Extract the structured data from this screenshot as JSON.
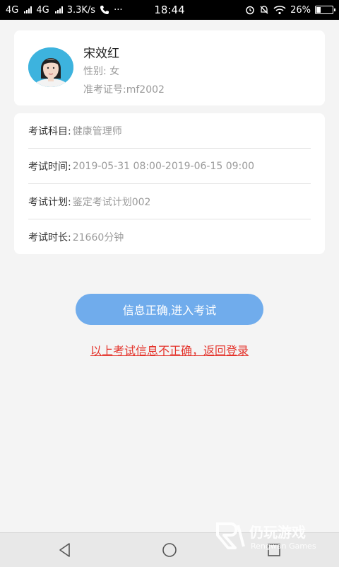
{
  "status_bar": {
    "network1": "4G",
    "network2": "4G",
    "speed": "3.3K/s",
    "more": "···",
    "time": "18:44",
    "battery": "26%",
    "battery_level": 0.26
  },
  "profile": {
    "name": "宋效红",
    "gender_label": "性别: ",
    "gender_value": "女",
    "examno_label": "准考证号:",
    "examno_value": "mf2002"
  },
  "exam_info": [
    {
      "label": "考试科目:",
      "value": "健康管理师"
    },
    {
      "label": "考试时间:",
      "value": "2019-05-31 08:00-2019-06-15 09:00"
    },
    {
      "label": "考试计划:",
      "value": "鉴定考试计划002"
    },
    {
      "label": "考试时长:",
      "value": "21660分钟"
    }
  ],
  "actions": {
    "enter_label": "信息正确,进入考试",
    "back_label": "以上考试信息不正确，返回登录"
  },
  "colors": {
    "button": "#70acec",
    "link": "#e4332b"
  },
  "watermark": {
    "title": "仍玩游戏",
    "subtitle": "Rengwan Games"
  }
}
